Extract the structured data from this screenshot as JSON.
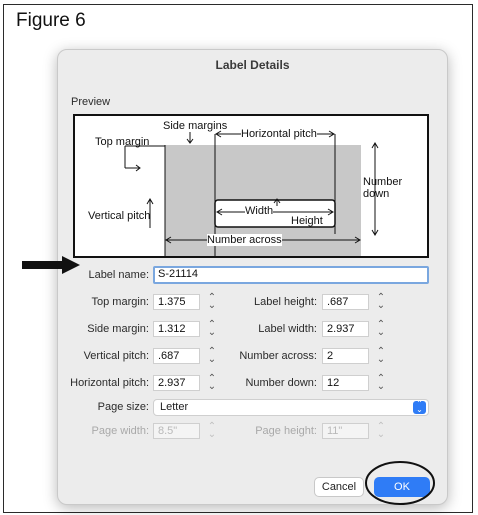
{
  "figure": {
    "title": "Figure 6"
  },
  "dialog": {
    "title": "Label Details",
    "preview_label": "Preview",
    "diagram": {
      "side_margins": "Side margins",
      "top_margin": "Top margin",
      "horizontal_pitch": "Horizontal pitch",
      "number_down_1": "Number",
      "number_down_2": "down",
      "vertical_pitch": "Vertical pitch",
      "width": "Width",
      "height": "Height",
      "number_across": "Number across"
    },
    "fields": {
      "label_name": {
        "label": "Label name:",
        "value": "S-21114"
      },
      "top_margin": {
        "label": "Top margin:",
        "value": "1.375"
      },
      "side_margin": {
        "label": "Side margin:",
        "value": "1.312"
      },
      "vertical_pitch": {
        "label": "Vertical pitch:",
        "value": ".687"
      },
      "horizontal_pitch": {
        "label": "Horizontal pitch:",
        "value": "2.937"
      },
      "label_height": {
        "label": "Label height:",
        "value": ".687"
      },
      "label_width": {
        "label": "Label width:",
        "value": "2.937"
      },
      "number_across": {
        "label": "Number across:",
        "value": "2"
      },
      "number_down": {
        "label": "Number down:",
        "value": "12"
      },
      "page_size": {
        "label": "Page size:",
        "value": "Letter"
      },
      "page_width": {
        "label": "Page width:",
        "value": "8.5\""
      },
      "page_height": {
        "label": "Page height:",
        "value": "11\""
      }
    },
    "buttons": {
      "cancel": "Cancel",
      "ok": "OK"
    },
    "accent_color": "#2f7cf6"
  }
}
